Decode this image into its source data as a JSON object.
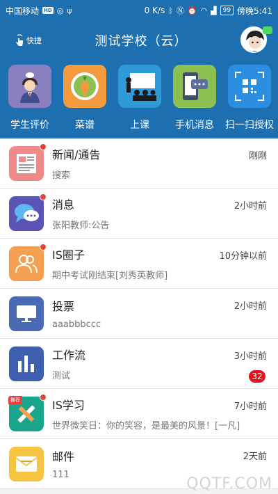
{
  "status": {
    "carrier": "中国移动",
    "hd": "HD",
    "speed": "0 K/s",
    "battery": "99",
    "time": "傍晚5:41"
  },
  "header": {
    "shortcut_label": "快捷",
    "title": "测试学校（云）"
  },
  "quick_items": [
    {
      "label": "学生评价",
      "icon": "student-evaluation-icon",
      "color": "#8a7fbf"
    },
    {
      "label": "菜谱",
      "icon": "carrot-recipe-icon",
      "color": "#f39a3e"
    },
    {
      "label": "上课",
      "icon": "classroom-icon",
      "color": "#2f9ad8"
    },
    {
      "label": "手机消息",
      "icon": "phone-message-icon",
      "color": "#8cc152"
    },
    {
      "label": "扫一扫授权",
      "icon": "qr-scan-icon",
      "color": "#2b8ee0"
    }
  ],
  "rows": [
    {
      "title": "新闻/通告",
      "subtitle": "搜索",
      "time": "刚刚",
      "icon": "news-icon",
      "color": "#f08a8a",
      "dot": true
    },
    {
      "title": "消息",
      "subtitle": "张阳教师:公告",
      "time": "2小时前",
      "icon": "chat-bubble-icon",
      "color": "#5c54b5",
      "dot": true
    },
    {
      "title": "IS圈子",
      "subtitle": "期中考试刚结束[刘秀英教师]",
      "time": "10分钟以前",
      "icon": "people-circle-icon",
      "color": "#f5a050",
      "dot": true
    },
    {
      "title": "投票",
      "subtitle": "aaabbbccc",
      "time": "2小时前",
      "icon": "monitor-vote-icon",
      "color": "#4a6bb3",
      "dot": false
    },
    {
      "title": "工作流",
      "subtitle": "测试",
      "time": "3小时前",
      "icon": "bar-chart-icon",
      "color": "#3e5fae",
      "dot": false,
      "count": "32"
    },
    {
      "title": "IS学习",
      "subtitle": "世界微笑日：你的笑容，是最美的风景！[一凡]",
      "time": "7小时前",
      "icon": "pencil-ruler-icon",
      "color": "#1aa68c",
      "dot": true,
      "tag": "推荐"
    },
    {
      "title": "邮件",
      "subtitle": "111",
      "time": "2天前",
      "icon": "envelope-icon",
      "color": "#f6c542",
      "dot": false
    }
  ],
  "watermark": "QQTF.COM"
}
